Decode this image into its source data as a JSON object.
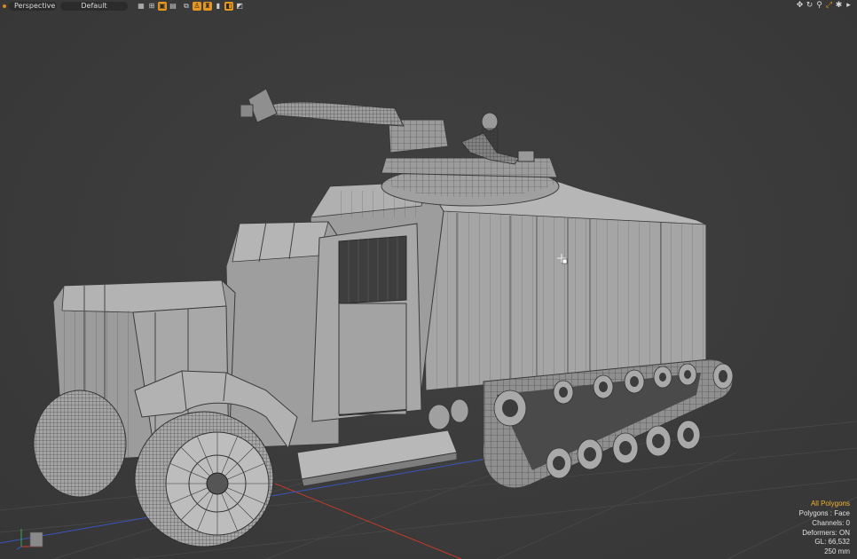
{
  "toolbar": {
    "view_label": "Perspective",
    "style_label": "Default",
    "icons": [
      {
        "name": "wireframe-icon",
        "on": false
      },
      {
        "name": "grid-snap-icon",
        "on": false
      },
      {
        "name": "shaded-toggle-icon",
        "on": true
      },
      {
        "name": "hatched-icon",
        "on": false
      },
      {
        "name": "clone-icon",
        "on": false
      },
      {
        "name": "person-icon",
        "on": true
      },
      {
        "name": "symmetry-icon",
        "on": true
      },
      {
        "name": "lock-icon",
        "on": false
      },
      {
        "name": "layers-icon",
        "on": true
      },
      {
        "name": "transform-icon",
        "on": false
      }
    ],
    "nav_icons": [
      "move-view-icon",
      "rotate-view-icon",
      "zoom-view-icon",
      "fit-view-icon",
      "viewport-settings-icon",
      "expand-menu-icon"
    ]
  },
  "hud": {
    "selection": "All Polygons",
    "polygons": "Polygons : Face",
    "channels": "Channels: 0",
    "deformers": "Deformers: ON",
    "gl": "GL: 66,532",
    "scale": "250 mm"
  },
  "colors": {
    "accent": "#e7961f",
    "hud_highlight": "#f0b030",
    "axis_x": "#d03a2a",
    "axis_y": "#3aa84a",
    "axis_z": "#3a5ad0",
    "mesh_fill": "#9a9a9a",
    "wire": "#3a3a3a"
  }
}
